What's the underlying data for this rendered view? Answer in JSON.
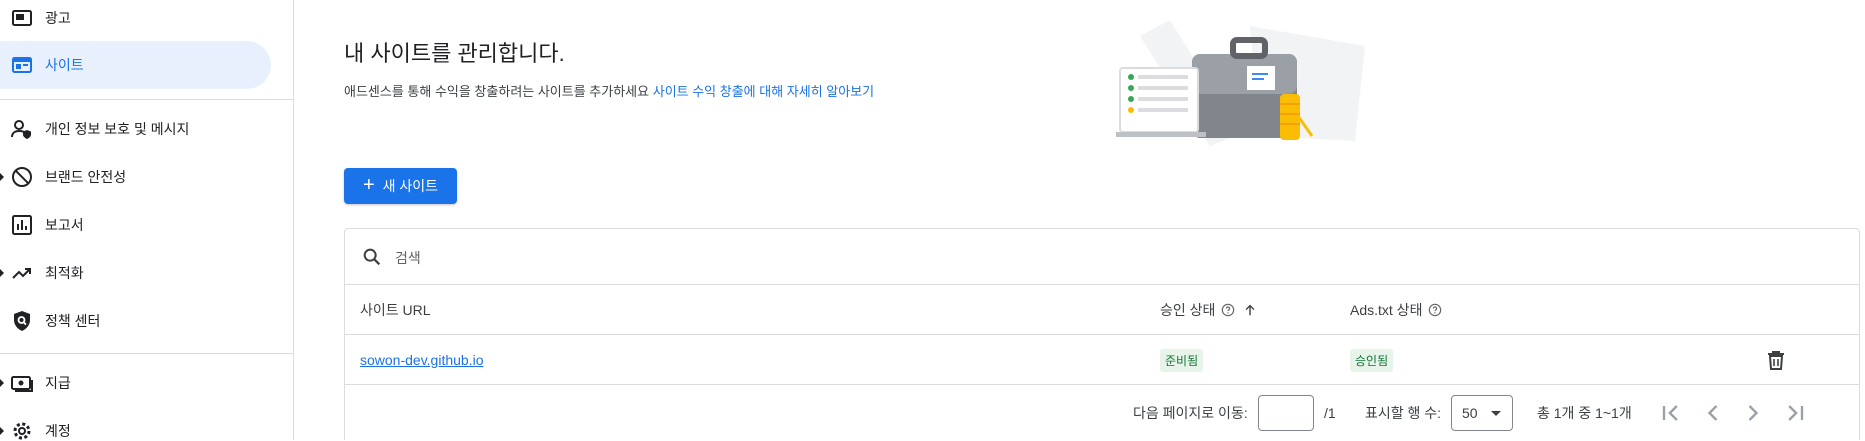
{
  "sidebar": {
    "items": [
      {
        "label": "광고",
        "icon": "ad-icon"
      },
      {
        "label": "사이트",
        "icon": "site-icon"
      },
      {
        "label": "개인 정보 보호 및 메시지",
        "icon": "privacy-icon"
      },
      {
        "label": "브랜드 안전성",
        "icon": "block-icon"
      },
      {
        "label": "보고서",
        "icon": "report-icon"
      },
      {
        "label": "최적화",
        "icon": "trending-icon"
      },
      {
        "label": "정책 센터",
        "icon": "policy-icon"
      },
      {
        "label": "지급",
        "icon": "payment-icon"
      },
      {
        "label": "계정",
        "icon": "settings-icon"
      }
    ]
  },
  "main": {
    "title": "내 사이트를 관리합니다.",
    "subtitle": "애드센스를 통해 수익을 창출하려는 사이트를 추가하세요",
    "learn_more_link": "사이트 수익 창출에 대해 자세히 알아보기",
    "new_site_button": "새 사이트"
  },
  "table": {
    "search_placeholder": "검색",
    "columns": {
      "site_url": "사이트 URL",
      "approval_status": "승인 상태",
      "ads_txt_status": "Ads.txt 상태"
    },
    "rows": [
      {
        "site_url": "sowon-dev.github.io",
        "approval_status": "준비됨",
        "ads_txt_status": "승인됨"
      }
    ]
  },
  "pagination": {
    "goto_label": "다음 페이지로 이동:",
    "page_input_value": "",
    "page_total": "/1",
    "rows_label": "표시할 행 수:",
    "rows_per_page": "50",
    "range_text": "총 1개 중 1~1개"
  },
  "colors": {
    "accent": "#1a73e8",
    "active_bg": "#e8f0fe",
    "badge_bg": "#e6f4ea",
    "badge_text": "#137333"
  }
}
